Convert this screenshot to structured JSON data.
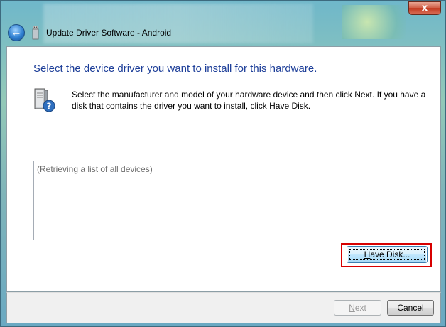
{
  "window": {
    "title": "Update Driver Software - Android",
    "close_label": "x"
  },
  "nav": {
    "back_glyph": "←"
  },
  "content": {
    "heading": "Select the device driver you want to install for this hardware.",
    "instructions": "Select the manufacturer and model of your hardware device and then click Next. If you have a disk that contains the driver you want to install, click Have Disk.",
    "device_list": {
      "status_text": "(Retrieving a list of all devices)"
    },
    "have_disk": {
      "mnemonic": "H",
      "rest": "ave Disk..."
    }
  },
  "footer": {
    "next": {
      "mnemonic": "N",
      "rest": "ext",
      "enabled": false
    },
    "cancel_label": "Cancel"
  },
  "icons": {
    "back": "back-arrow-icon",
    "title": "usb-device-icon",
    "hardware": "hardware-unknown-device-icon"
  },
  "colors": {
    "heading": "#1e3f99",
    "highlight_border": "#d70000",
    "close_button": "#c2391e"
  }
}
